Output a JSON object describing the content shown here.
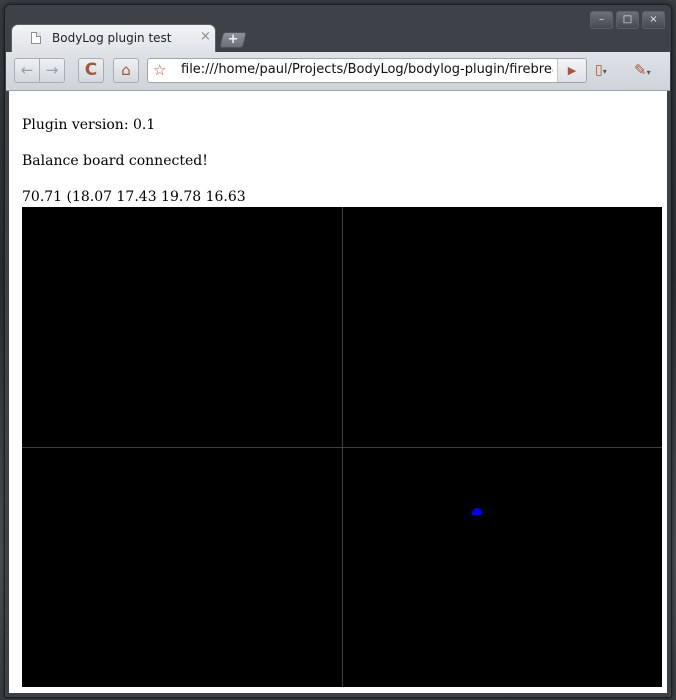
{
  "tab": {
    "title": "BodyLog plugin test",
    "close_glyph": "×",
    "new_tab_glyph": "+"
  },
  "window_controls": {
    "minimize": "–",
    "maximize": "□",
    "close": "×"
  },
  "toolbar": {
    "back_glyph": "←",
    "forward_glyph": "→",
    "reload_glyph": "C",
    "home_glyph": "⌂",
    "star_glyph": "☆",
    "url": "file:///home/paul/Projects/BodyLog/bodylog-plugin/firebreath/p",
    "go_glyph": "▶",
    "page_menu_glyph": "▯",
    "wrench_glyph": "✎",
    "menu_caret": "▾"
  },
  "content": {
    "plugin_version": "Plugin version: 0.1",
    "status": "Balance board connected!",
    "readings": "70.71 (18.07 17.43 19.78 16.63"
  },
  "colors": {
    "canvas_background": "#000000",
    "axis_lines": "#3f3f3f",
    "center_of_pressure_dot": "#0000ee",
    "accent": "#a8553f"
  },
  "icons": [
    "document-icon",
    "back-arrow-icon",
    "forward-arrow-icon",
    "reload-icon",
    "home-icon",
    "star-icon",
    "go-arrow-icon",
    "page-menu-icon",
    "wrench-icon"
  ]
}
